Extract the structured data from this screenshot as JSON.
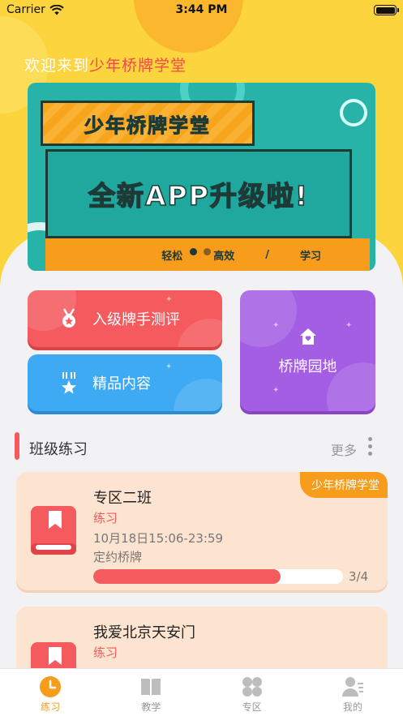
{
  "status_bar": {
    "carrier": "Carrier",
    "time": "3:44 PM"
  },
  "header": {
    "welcome_prefix": "欢迎来到",
    "welcome_highlight": "少年桥牌学堂"
  },
  "banner": {
    "tag_text": "少年桥牌学堂",
    "headline": "全新APP升级啦!",
    "strip_words": [
      "轻松",
      "高效",
      "/",
      "学习"
    ],
    "page_count": 2,
    "current_page": 1
  },
  "menu": {
    "evaluation": {
      "label": "入级牌手测评",
      "icon": "medal-icon"
    },
    "content": {
      "label": "精品内容",
      "icon": "star-award-icon"
    },
    "garden": {
      "label": "桥牌园地",
      "icon": "house-icon"
    }
  },
  "section": {
    "title": "班级练习",
    "more_label": "更多"
  },
  "cards": [
    {
      "badge": "少年桥牌学堂",
      "title": "专区二班",
      "kind": "练习",
      "time": "10月18日15:06-23:59",
      "subtitle": "定约桥牌",
      "progress_fraction": 0.75,
      "progress_text": "3/4"
    },
    {
      "title": "我爱北京天安门",
      "kind": "练习"
    }
  ],
  "tabbar": {
    "tabs": [
      {
        "label": "练习",
        "icon": "clock-icon",
        "active": true
      },
      {
        "label": "教学",
        "icon": "book-open-icon",
        "active": false
      },
      {
        "label": "专区",
        "icon": "grid-dots-icon",
        "active": false
      },
      {
        "label": "我的",
        "icon": "user-icon",
        "active": false
      }
    ]
  },
  "colors": {
    "header_yellow": "#fcd43e",
    "accent_red": "#f45a5e",
    "accent_blue": "#3eaaf3",
    "accent_purple": "#a45ee4",
    "accent_orange": "#f79c1b",
    "card_bg": "#fde4d0"
  }
}
